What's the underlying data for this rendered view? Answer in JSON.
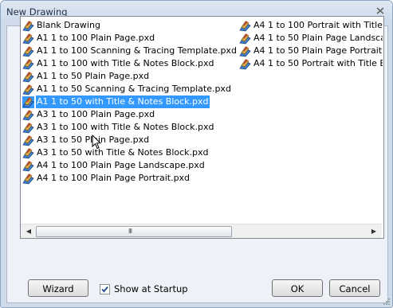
{
  "window": {
    "title": "New Drawing"
  },
  "list": {
    "column1": [
      {
        "label": "Blank Drawing"
      },
      {
        "label": "A1 1 to 100 Plain Page.pxd"
      },
      {
        "label": "A1 1 to 100 Scanning & Tracing Template.pxd"
      },
      {
        "label": "A1 1 to 100 with Title & Notes Block.pxd"
      },
      {
        "label": "A1 1 to 50 Plain Page.pxd"
      },
      {
        "label": "A1 1 to 50 Scanning & Tracing Template.pxd"
      },
      {
        "label": "A1 1 to 50 with Title & Notes Block.pxd",
        "selected": true
      },
      {
        "label": "A3 1 to 100 Plain Page.pxd"
      },
      {
        "label": "A3 1 to 100 with Title & Notes Block.pxd"
      },
      {
        "label": "A3 1 to 50 Plain Page.pxd"
      },
      {
        "label": "A3 1 to 50 with Title & Notes Block.pxd"
      },
      {
        "label": "A4 1 to 100 Plain Page Landscape.pxd"
      },
      {
        "label": "A4 1 to 100 Plain Page Portrait.pxd"
      }
    ],
    "column2": [
      {
        "label": "A4 1 to 100 Portrait with Title"
      },
      {
        "label": "A4 1 to 50 Plain Page Landsca"
      },
      {
        "label": "A4 1 to 50 Plain Page Portrait"
      },
      {
        "label": "A4 1 to 50 Portrait with Title B"
      }
    ],
    "scrollbar": {
      "grip": "III"
    }
  },
  "buttons": {
    "wizard": "Wizard",
    "ok": "OK",
    "cancel": "Cancel"
  },
  "startup_checkbox": {
    "label": "Show at Startup",
    "checked": true
  },
  "icons": {
    "item": "drawing-document-icon",
    "close": "close-icon"
  },
  "colors": {
    "selection": "#3399ff",
    "frame": "#cfdbea"
  }
}
